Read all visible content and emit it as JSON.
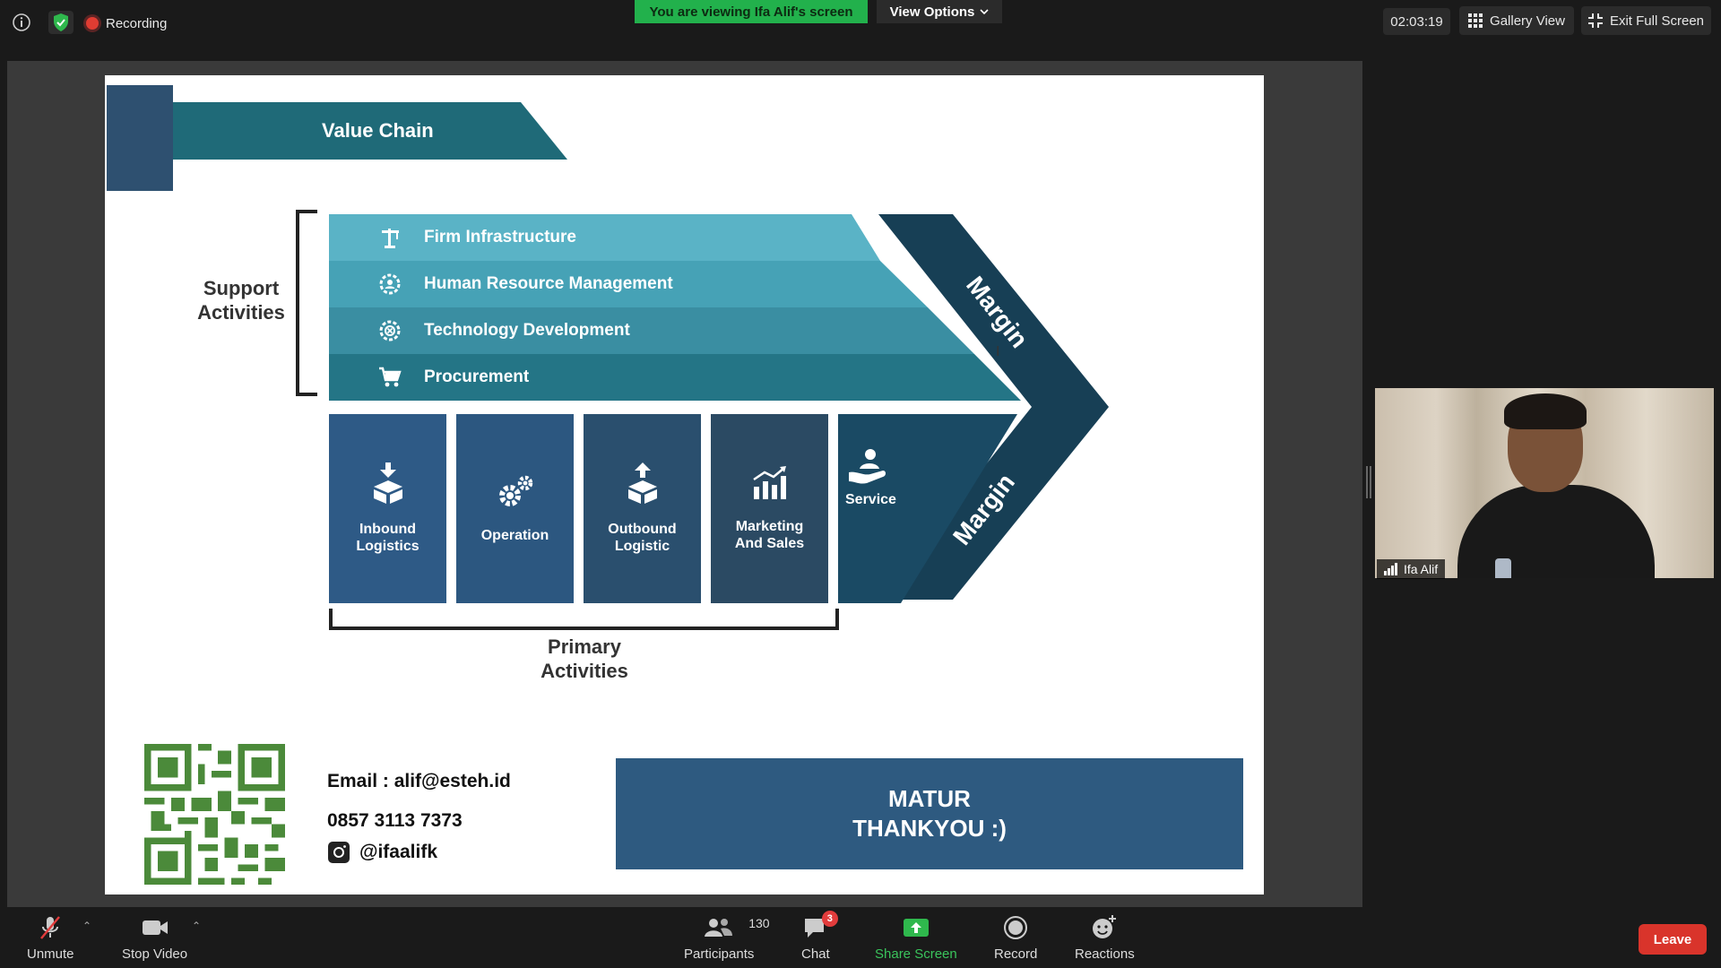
{
  "topbar": {
    "recording_label": "Recording",
    "viewing_banner": "You are viewing Ifa Alif's screen",
    "view_options": "View Options",
    "timer": "02:03:19",
    "gallery_view": "Gallery View",
    "exit_full_screen": "Exit Full Screen"
  },
  "slide": {
    "title": "Value Chain",
    "support_label": "Support Activities",
    "support_lines": [
      "Support",
      "Activities"
    ],
    "support_activities": [
      {
        "label": "Firm Infrastructure",
        "icon": "crane-icon"
      },
      {
        "label": "Human Resource Management",
        "icon": "people-gear-icon"
      },
      {
        "label": "Technology Development",
        "icon": "tech-gear-icon"
      },
      {
        "label": "Procurement",
        "icon": "cart-icon"
      }
    ],
    "primary_activities": [
      {
        "line1": "Inbound",
        "line2": "Logistics",
        "icon": "box-in-icon"
      },
      {
        "line1": "Operation",
        "line2": "",
        "icon": "gears-icon"
      },
      {
        "line1": "Outbound",
        "line2": "Logistic",
        "icon": "box-out-icon"
      },
      {
        "line1": "Marketing",
        "line2": "And Sales",
        "icon": "chart-icon"
      },
      {
        "line1": "Service",
        "line2": "",
        "icon": "service-icon"
      }
    ],
    "margin_label": "Margin",
    "primary_lines": [
      "Primary",
      "Activities"
    ],
    "contact": {
      "email": "Email : alif@esteh.id",
      "phone": "0857 3113 7373",
      "instagram": "@ifaalifk"
    },
    "thanks_lines": [
      "MATUR",
      "THANKYOU :)"
    ],
    "colors": {
      "band1": "#5ab3c6",
      "band2": "#46a2b6",
      "band3": "#3a8ea2",
      "band4": "#247586",
      "margin": "#173f55",
      "primary": "#2e5a86",
      "qr": "#4b8a3a"
    }
  },
  "participant": {
    "name": "Ifa Alif"
  },
  "toolbar": {
    "unmute": "Unmute",
    "stop_video": "Stop Video",
    "participants": "Participants",
    "participants_count": "130",
    "chat": "Chat",
    "chat_badge": "3",
    "share_screen": "Share Screen",
    "record": "Record",
    "reactions": "Reactions",
    "leave": "Leave"
  }
}
